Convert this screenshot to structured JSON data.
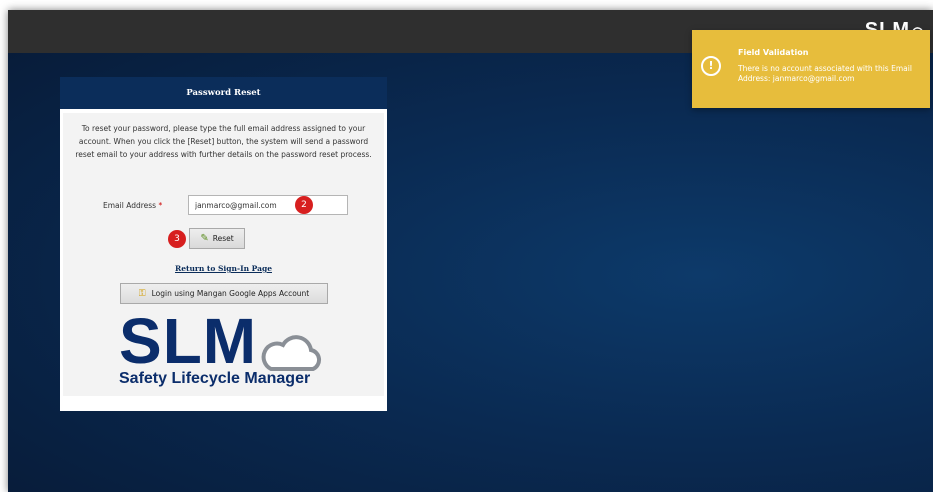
{
  "header": {
    "brand": "SLM"
  },
  "toast": {
    "title": "Field Validation",
    "message": "There is no account associated with this Email Address: janmarco@gmail.com",
    "icon": "warning-circle-icon",
    "color": "#e7bd3c"
  },
  "panel": {
    "title": "Password Reset",
    "instructions": "To reset your password, please type the full email address assigned to your account. When you click the [Reset] button, the system will send a password reset email to your address with further details on the password reset process.",
    "email_label": "Email Address",
    "required_mark": "*",
    "email_value": "janmarco@gmail.com",
    "reset_label": "Reset",
    "return_link": "Return to Sign-In Page",
    "google_label": "Login using Mangan Google Apps Account",
    "header_color": "#0b2d5a"
  },
  "steps": {
    "email": "2",
    "reset": "3"
  },
  "logo": {
    "letters": "SLM",
    "tagline": "Safety Lifecycle Manager"
  }
}
